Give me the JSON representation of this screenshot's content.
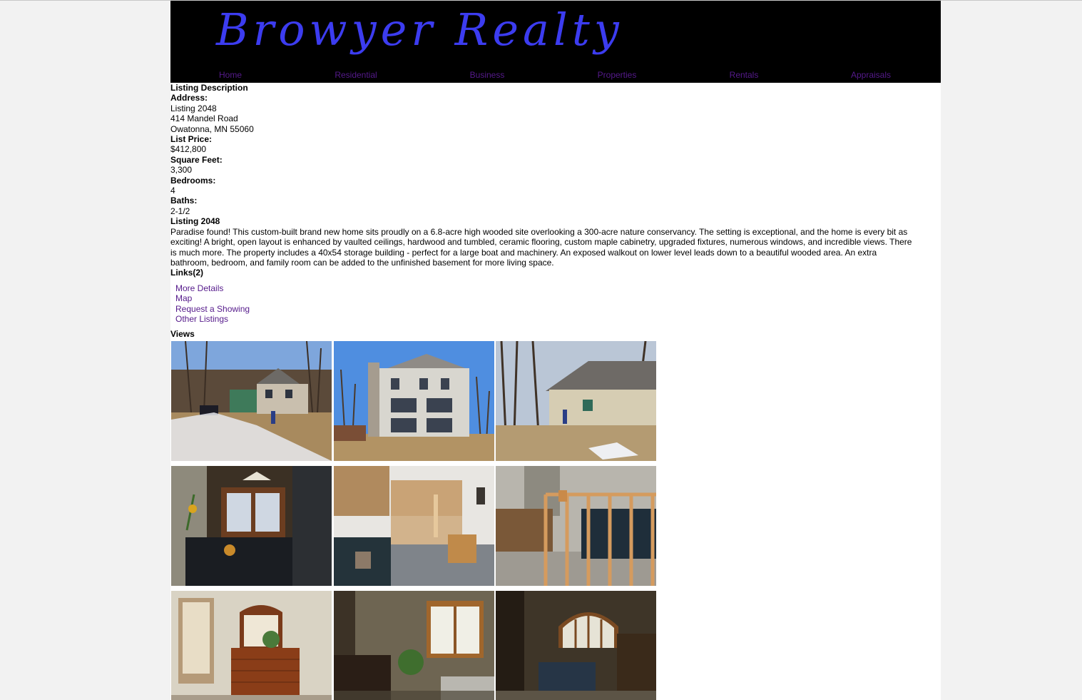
{
  "header": {
    "brand": "Browyer Realty",
    "nav": [
      "Home",
      "Residential",
      "Business",
      "Properties",
      "Rentals",
      "Appraisals"
    ]
  },
  "listing": {
    "section_title": "Listing Description",
    "address_label": "Address:",
    "address_lines": [
      "Listing 2048",
      "414 Mandel Road",
      "Owatonna, MN 55060"
    ],
    "price_label": "List Price:",
    "price": "$412,800",
    "sqft_label": "Square Feet:",
    "sqft": "3,300",
    "bedrooms_label": "Bedrooms:",
    "bedrooms": "4",
    "baths_label": "Baths:",
    "baths": "2-1/2",
    "desc_title": "Listing 2048",
    "description": "Paradise found! This custom-built brand new home sits proudly on a 6.8-acre high wooded site overlooking a 300-acre nature conservancy. The setting is exceptional, and the home is every bit as exciting! A bright, open layout is enhanced by vaulted ceilings, hardwood and tumbled, ceramic flooring, custom maple cabinetry, upgraded fixtures, numerous windows, and incredible views. There is much more. The property includes a 40x54 storage building - perfect for a large boat and machinery. An exposed walkout on lower level leads down to a beautiful wooded area. An extra bathroom, bedroom, and family room can be added to the unfinished basement for more living space."
  },
  "links": {
    "title": "Links(2)",
    "items": [
      "More Details",
      "Map",
      "Request a Showing",
      "Other Listings"
    ]
  },
  "views": {
    "title": "Views",
    "photos": [
      "house-front-exterior-photo",
      "house-rear-exterior-photo",
      "house-side-exterior-photo",
      "dining-room-photo",
      "kitchen-photo",
      "staircase-photo",
      "bedroom-dresser-photo",
      "bedroom-window-photo",
      "arched-window-room-photo"
    ]
  },
  "colors": {
    "header_bg": "#000000",
    "brand": "#3c3cf0",
    "link": "#551a8b",
    "page_bg": "#f2f2f2"
  }
}
